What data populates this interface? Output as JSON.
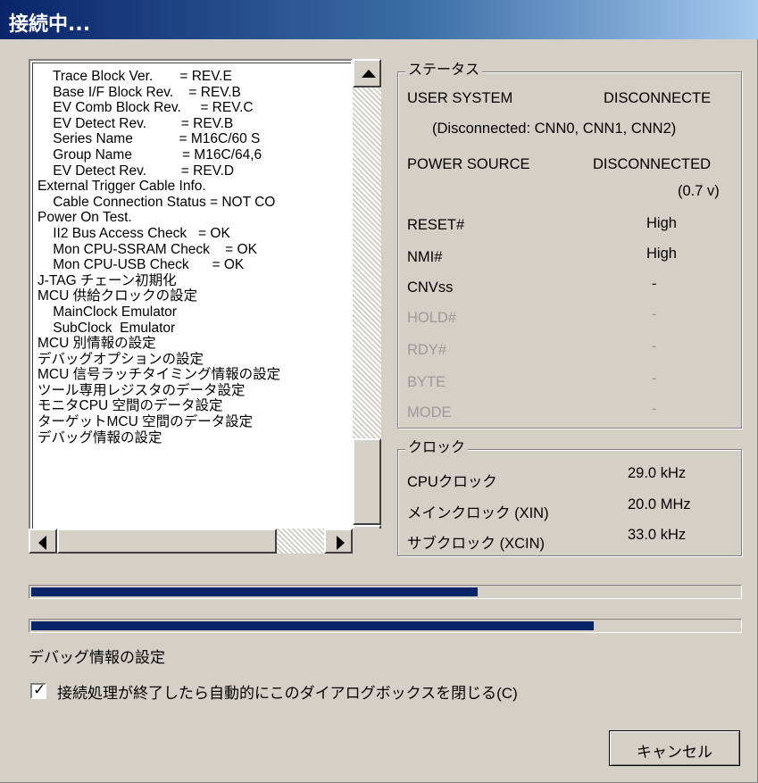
{
  "window": {
    "title": "接続中..."
  },
  "log": {
    "lines": [
      "    Trace Block Ver.       = REV.E",
      "    Base I/F Block Rev.    = REV.B",
      "    EV Comb Block Rev.     = REV.C",
      "    EV Detect Rev.         = REV.B",
      "    Series Name            = M16C/60 S",
      "    Group Name             = M16C/64,6",
      "    EV Detect Rev.         = REV.D",
      "External Trigger Cable Info.",
      "    Cable Connection Status = NOT CO",
      "Power On Test.",
      "    II2 Bus Access Check   = OK",
      "    Mon CPU-SSRAM Check    = OK",
      "    Mon CPU-USB Check      = OK",
      "J-TAG チェーン初期化",
      "MCU 供給クロックの設定",
      "    MainClock Emulator",
      "    SubClock  Emulator",
      "MCU 別情報の設定",
      "デバッグオプションの設定",
      "MCU 信号ラッチタイミング情報の設定",
      "ツール専用レジスタのデータ設定",
      "モニタCPU 空間のデータ設定",
      "ターゲットMCU 空間のデータ設定",
      "デバッグ情報の設定"
    ]
  },
  "status": {
    "title": "ステータス",
    "user_system_label": "USER SYSTEM",
    "user_system_value": "DISCONNECTE",
    "user_system_detail": "(Disconnected: CNN0, CNN1, CNN2)",
    "power_source_label": "POWER SOURCE",
    "power_source_value": "DISCONNECTED",
    "power_source_volt": "(0.7 v)",
    "signals": [
      {
        "name": "RESET#",
        "value": "High",
        "enabled": true
      },
      {
        "name": "NMI#",
        "value": "High",
        "enabled": true
      },
      {
        "name": "CNVss",
        "value": "-",
        "enabled": true
      },
      {
        "name": "HOLD#",
        "value": "-",
        "enabled": false
      },
      {
        "name": "RDY#",
        "value": "-",
        "enabled": false
      },
      {
        "name": "BYTE",
        "value": "-",
        "enabled": false
      },
      {
        "name": "MODE",
        "value": "-",
        "enabled": false
      }
    ]
  },
  "clock": {
    "title": "クロック",
    "rows": [
      {
        "name": "CPUクロック",
        "value": "29.0 kHz"
      },
      {
        "name": "メインクロック (XIN)",
        "value": "20.0 MHz"
      },
      {
        "name": "サブクロック (XCIN)",
        "value": "33.0 kHz"
      }
    ]
  },
  "progress": {
    "overall": 0.63,
    "step": 0.795
  },
  "step_text": "デバッグ情報の設定",
  "auto_close": {
    "checked": true,
    "label": "接続処理が終了したら自動的にこのダイアログボックスを閉じる(C)"
  },
  "buttons": {
    "cancel": "キャンセル"
  },
  "colors": {
    "title_start": "#0a246a",
    "title_end": "#a6caf0",
    "progress": "#0a246a",
    "face": "#d4d0c8"
  }
}
